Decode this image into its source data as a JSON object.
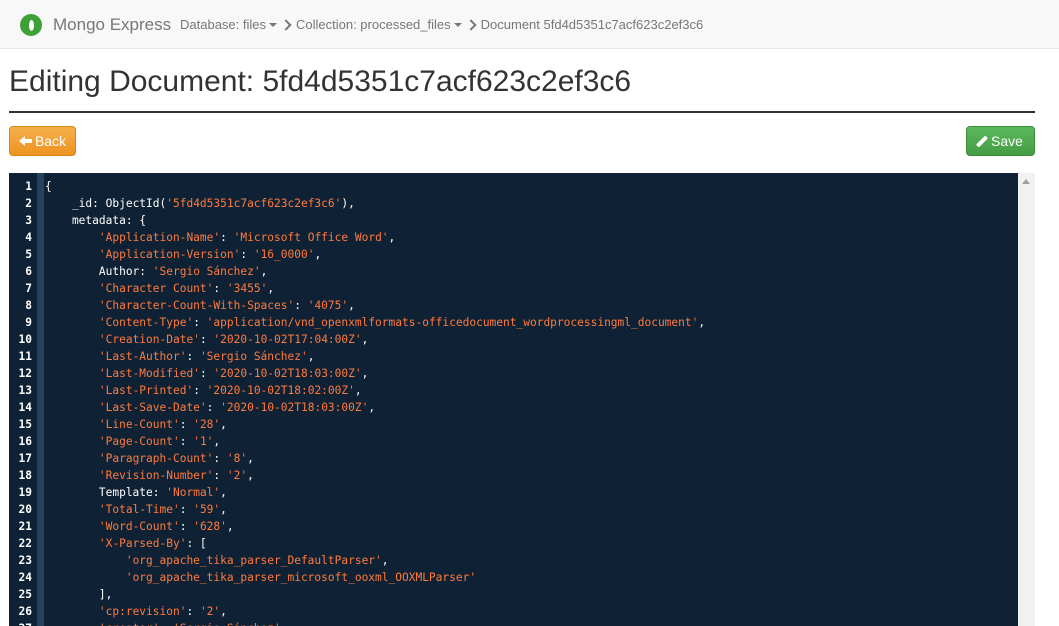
{
  "navbar": {
    "brand": "Mongo Express",
    "breadcrumbs": [
      {
        "label": "Database: files",
        "dropdown": true
      },
      {
        "label": "Collection: processed_files",
        "dropdown": true
      },
      {
        "label": "Document 5fd4d5351c7acf623c2ef3c6",
        "dropdown": false
      }
    ]
  },
  "page": {
    "title": "Editing Document: 5fd4d5351c7acf623c2ef3c6"
  },
  "buttons": {
    "back": "Back",
    "save": "Save"
  },
  "colors": {
    "back": "#f0ad4e",
    "save": "#5cb85c",
    "editor_bg": "#0f2235",
    "string": "#ff7a3d"
  },
  "editor": {
    "lines": [
      [
        {
          "t": "{",
          "c": "p"
        }
      ],
      [
        {
          "t": "    _id",
          "c": "k"
        },
        {
          "t": ": ObjectId(",
          "c": "p"
        },
        {
          "t": "'5fd4d5351c7acf623c2ef3c6'",
          "c": "s"
        },
        {
          "t": "),",
          "c": "p"
        }
      ],
      [
        {
          "t": "    metadata",
          "c": "k"
        },
        {
          "t": ": {",
          "c": "p"
        }
      ],
      [
        {
          "t": "        ",
          "c": "p"
        },
        {
          "t": "'Application-Name'",
          "c": "s"
        },
        {
          "t": ": ",
          "c": "p"
        },
        {
          "t": "'Microsoft Office Word'",
          "c": "s"
        },
        {
          "t": ",",
          "c": "p"
        }
      ],
      [
        {
          "t": "        ",
          "c": "p"
        },
        {
          "t": "'Application-Version'",
          "c": "s"
        },
        {
          "t": ": ",
          "c": "p"
        },
        {
          "t": "'16_0000'",
          "c": "s"
        },
        {
          "t": ",",
          "c": "p"
        }
      ],
      [
        {
          "t": "        Author",
          "c": "k"
        },
        {
          "t": ": ",
          "c": "p"
        },
        {
          "t": "'Sergio Sánchez'",
          "c": "s"
        },
        {
          "t": ",",
          "c": "p"
        }
      ],
      [
        {
          "t": "        ",
          "c": "p"
        },
        {
          "t": "'Character Count'",
          "c": "s"
        },
        {
          "t": ": ",
          "c": "p"
        },
        {
          "t": "'3455'",
          "c": "s"
        },
        {
          "t": ",",
          "c": "p"
        }
      ],
      [
        {
          "t": "        ",
          "c": "p"
        },
        {
          "t": "'Character-Count-With-Spaces'",
          "c": "s"
        },
        {
          "t": ": ",
          "c": "p"
        },
        {
          "t": "'4075'",
          "c": "s"
        },
        {
          "t": ",",
          "c": "p"
        }
      ],
      [
        {
          "t": "        ",
          "c": "p"
        },
        {
          "t": "'Content-Type'",
          "c": "s"
        },
        {
          "t": ": ",
          "c": "p"
        },
        {
          "t": "'application/vnd_openxmlformats-officedocument_wordprocessingml_document'",
          "c": "s"
        },
        {
          "t": ",",
          "c": "p"
        }
      ],
      [
        {
          "t": "        ",
          "c": "p"
        },
        {
          "t": "'Creation-Date'",
          "c": "s"
        },
        {
          "t": ": ",
          "c": "p"
        },
        {
          "t": "'2020-10-02T17:04:00Z'",
          "c": "s"
        },
        {
          "t": ",",
          "c": "p"
        }
      ],
      [
        {
          "t": "        ",
          "c": "p"
        },
        {
          "t": "'Last-Author'",
          "c": "s"
        },
        {
          "t": ": ",
          "c": "p"
        },
        {
          "t": "'Sergio Sánchez'",
          "c": "s"
        },
        {
          "t": ",",
          "c": "p"
        }
      ],
      [
        {
          "t": "        ",
          "c": "p"
        },
        {
          "t": "'Last-Modified'",
          "c": "s"
        },
        {
          "t": ": ",
          "c": "p"
        },
        {
          "t": "'2020-10-02T18:03:00Z'",
          "c": "s"
        },
        {
          "t": ",",
          "c": "p"
        }
      ],
      [
        {
          "t": "        ",
          "c": "p"
        },
        {
          "t": "'Last-Printed'",
          "c": "s"
        },
        {
          "t": ": ",
          "c": "p"
        },
        {
          "t": "'2020-10-02T18:02:00Z'",
          "c": "s"
        },
        {
          "t": ",",
          "c": "p"
        }
      ],
      [
        {
          "t": "        ",
          "c": "p"
        },
        {
          "t": "'Last-Save-Date'",
          "c": "s"
        },
        {
          "t": ": ",
          "c": "p"
        },
        {
          "t": "'2020-10-02T18:03:00Z'",
          "c": "s"
        },
        {
          "t": ",",
          "c": "p"
        }
      ],
      [
        {
          "t": "        ",
          "c": "p"
        },
        {
          "t": "'Line-Count'",
          "c": "s"
        },
        {
          "t": ": ",
          "c": "p"
        },
        {
          "t": "'28'",
          "c": "s"
        },
        {
          "t": ",",
          "c": "p"
        }
      ],
      [
        {
          "t": "        ",
          "c": "p"
        },
        {
          "t": "'Page-Count'",
          "c": "s"
        },
        {
          "t": ": ",
          "c": "p"
        },
        {
          "t": "'1'",
          "c": "s"
        },
        {
          "t": ",",
          "c": "p"
        }
      ],
      [
        {
          "t": "        ",
          "c": "p"
        },
        {
          "t": "'Paragraph-Count'",
          "c": "s"
        },
        {
          "t": ": ",
          "c": "p"
        },
        {
          "t": "'8'",
          "c": "s"
        },
        {
          "t": ",",
          "c": "p"
        }
      ],
      [
        {
          "t": "        ",
          "c": "p"
        },
        {
          "t": "'Revision-Number'",
          "c": "s"
        },
        {
          "t": ": ",
          "c": "p"
        },
        {
          "t": "'2'",
          "c": "s"
        },
        {
          "t": ",",
          "c": "p"
        }
      ],
      [
        {
          "t": "        Template",
          "c": "k"
        },
        {
          "t": ": ",
          "c": "p"
        },
        {
          "t": "'Normal'",
          "c": "s"
        },
        {
          "t": ",",
          "c": "p"
        }
      ],
      [
        {
          "t": "        ",
          "c": "p"
        },
        {
          "t": "'Total-Time'",
          "c": "s"
        },
        {
          "t": ": ",
          "c": "p"
        },
        {
          "t": "'59'",
          "c": "s"
        },
        {
          "t": ",",
          "c": "p"
        }
      ],
      [
        {
          "t": "        ",
          "c": "p"
        },
        {
          "t": "'Word-Count'",
          "c": "s"
        },
        {
          "t": ": ",
          "c": "p"
        },
        {
          "t": "'628'",
          "c": "s"
        },
        {
          "t": ",",
          "c": "p"
        }
      ],
      [
        {
          "t": "        ",
          "c": "p"
        },
        {
          "t": "'X-Parsed-By'",
          "c": "s"
        },
        {
          "t": ": [",
          "c": "p"
        }
      ],
      [
        {
          "t": "            ",
          "c": "p"
        },
        {
          "t": "'org_apache_tika_parser_DefaultParser'",
          "c": "s"
        },
        {
          "t": ",",
          "c": "p"
        }
      ],
      [
        {
          "t": "            ",
          "c": "p"
        },
        {
          "t": "'org_apache_tika_parser_microsoft_ooxml_OOXMLParser'",
          "c": "s"
        }
      ],
      [
        {
          "t": "        ],",
          "c": "p"
        }
      ],
      [
        {
          "t": "        ",
          "c": "p"
        },
        {
          "t": "'cp:revision'",
          "c": "s"
        },
        {
          "t": ": ",
          "c": "p"
        },
        {
          "t": "'2'",
          "c": "s"
        },
        {
          "t": ",",
          "c": "p"
        }
      ],
      [
        {
          "t": "        ",
          "c": "p"
        },
        {
          "t": "'creator'",
          "c": "s"
        },
        {
          "t": ": ",
          "c": "p"
        },
        {
          "t": "'Sergio Sánchez'",
          "c": "s"
        },
        {
          "t": ",",
          "c": "p"
        }
      ]
    ]
  }
}
